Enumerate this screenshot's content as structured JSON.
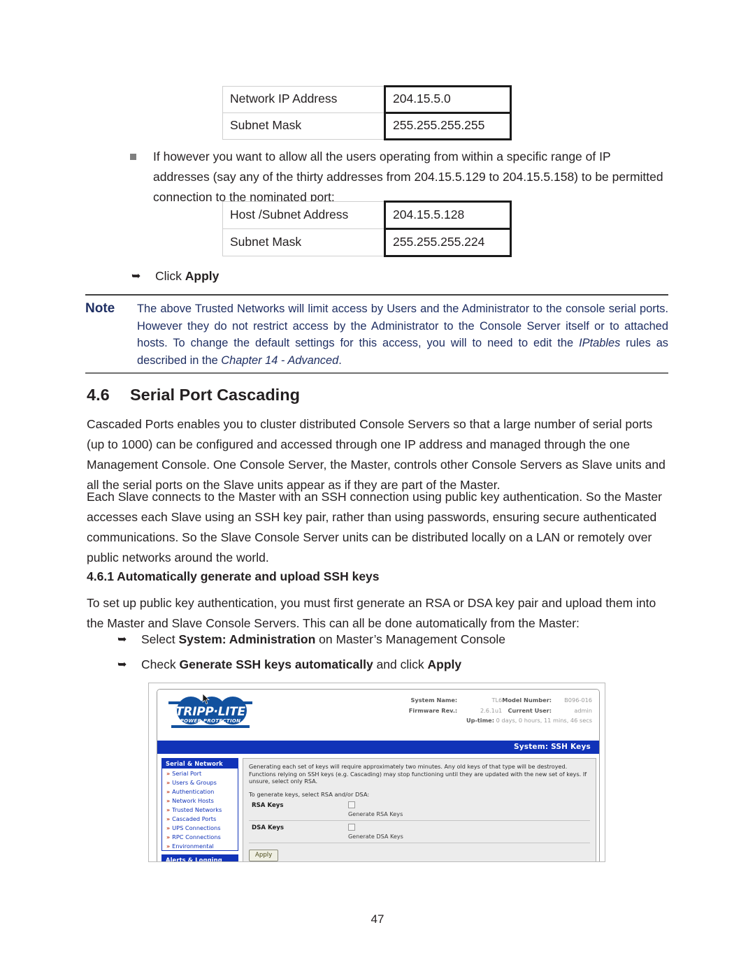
{
  "doc": {
    "page_number": "47"
  },
  "table_network": {
    "rows": [
      {
        "key": "Network IP Address",
        "value": "204.15.5.0"
      },
      {
        "key": "Subnet Mask",
        "value": "255.255.255.255"
      }
    ]
  },
  "bullet_range": {
    "text": "If however you want to allow all the users operating from within a specific range of IP addresses (say any of the thirty addresses from 204.15.5.129 to 204.15.5.158) to be permitted connection to the nominated port:"
  },
  "table_host": {
    "rows": [
      {
        "key": "Host /Subnet Address",
        "value": "204.15.5.128"
      },
      {
        "key": "Subnet Mask",
        "value": "255.255.255.224"
      }
    ]
  },
  "arrow_apply": {
    "lead": "Click ",
    "bold": "Apply"
  },
  "note": {
    "label": "Note",
    "part1": "The above Trusted Networks will limit access by Users and the Administrator to the console serial ports. However they do not restrict access by the Administrator to the Console Server itself or to attached hosts. To change the default settings for this access, you will to need to edit the ",
    "italic1": "IPtables",
    "part2": " rules as described in the ",
    "italic2": "Chapter 14 - Advanced",
    "part3": "."
  },
  "heading_46": {
    "number": "4.6",
    "title": "Serial Port Cascading"
  },
  "para_1": "Cascaded Ports enables you to cluster distributed Console Servers so that a large number of serial ports (up to 1000) can be configured and accessed through one IP address and managed through the one Management Console. One Console Server, the Master, controls other Console Servers as Slave units and all the serial ports on the Slave units appear as if they are part of the Master.",
  "para_2": "Each Slave connects to the Master with an SSH connection using public key authentication. So the Master accesses each Slave using an SSH key pair, rather than using passwords, ensuring secure authenticated communications. So the Slave Console Server units can be distributed locally on a LAN or remotely over public networks around the world.",
  "heading_461": "4.6.1 Automatically generate and upload SSH keys",
  "para_3": "To set up public key authentication, you must first generate an RSA or DSA key pair and upload them into the Master and Slave Console Servers. This can all be done automatically from the Master:",
  "arrow_select": {
    "lead": "Select ",
    "bold": "System: Administration",
    "tail": " on Master’s Management Console"
  },
  "arrow_check": {
    "lead": "Check ",
    "bold1": "Generate SSH keys automatically",
    "mid": " and click ",
    "bold2": "Apply"
  },
  "console": {
    "logo": {
      "wordmark": "TRIPP·LITE",
      "tagline": "POWER PROTECTION"
    },
    "sysinfo": {
      "system_name_label": "System Name:",
      "system_name_value": "TL6",
      "firmware_label": "Firmware Rev.:",
      "firmware_value": "2.6.1u1",
      "model_label": "Model Number:",
      "model_value": "B096-016",
      "user_label": "Current User:",
      "user_value": "admin",
      "uptime_label": "Up-time:",
      "uptime_value": "0 days, 0 hours, 11 mins, 46 secs"
    },
    "titlebar": "System: SSH Keys",
    "sidebar": [
      {
        "header": "Serial & Network",
        "items": [
          "Serial Port",
          "Users & Groups",
          "Authentication",
          "Network Hosts",
          "Trusted Networks",
          "Cascaded Ports",
          "UPS Connections",
          "RPC Connections",
          "Environmental"
        ]
      },
      {
        "header": "Alerts & Logging",
        "items": []
      }
    ],
    "main": {
      "intro": "Generating each set of keys will require approximately two minutes. Any old keys of that type will be destroyed. Functions relying on SSH keys (e.g. Cascading) may stop functioning until they are updated with the new set of keys. If unsure, select only RSA.",
      "prompt": "To generate keys, select RSA and/or DSA:",
      "rsa_label": "RSA Keys",
      "rsa_caption": "Generate RSA Keys",
      "dsa_label": "DSA Keys",
      "dsa_caption": "Generate DSA Keys",
      "apply_label": "Apply"
    }
  },
  "colors": {
    "note_blue": "#1f2f63",
    "console_blue": "#1133b8",
    "logo_blue": "#12519e",
    "chevron_red": "#c03a1d",
    "body_black": "#231f20"
  }
}
